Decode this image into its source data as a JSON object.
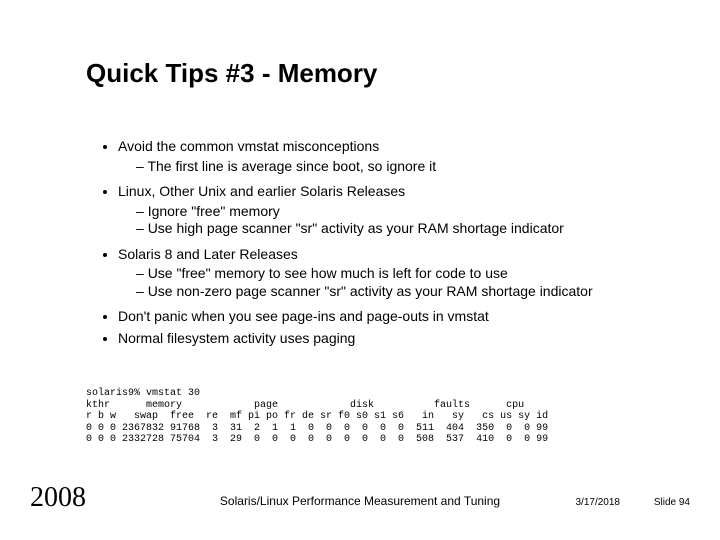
{
  "title": "Quick Tips #3 - Memory",
  "bullets": {
    "b1": "Avoid the common vmstat misconceptions",
    "b1s1": "The first line is average since boot, so ignore it",
    "b2": "Linux, Other Unix and earlier Solaris Releases",
    "b2s1": "Ignore \"free\" memory",
    "b2s2": "Use high page scanner \"sr\" activity as your RAM shortage indicator",
    "b3": "Solaris 8 and Later Releases",
    "b3s1": "Use \"free\" memory to see how much is left for code to use",
    "b3s2": "Use non-zero page scanner \"sr\" activity as your RAM shortage indicator",
    "b4": "Don't panic when you see page-ins and page-outs in vmstat",
    "b5": "Normal filesystem activity uses paging"
  },
  "mono": "solaris9% vmstat 30\nkthr      memory            page            disk          faults      cpu\nr b w   swap  free  re  mf pi po fr de sr f0 s0 s1 s6   in   sy   cs us sy id\n0 0 0 2367832 91768  3  31  2  1  1  0  0  0  0  0  0  511  404  350  0  0 99\n0 0 0 2332728 75704  3  29  0  0  0  0  0  0  0  0  0  508  537  410  0  0 99",
  "footer": {
    "year": "2008",
    "title": "Solaris/Linux Performance Measurement and Tuning",
    "date": "3/17/2018",
    "slide": "Slide 94"
  }
}
